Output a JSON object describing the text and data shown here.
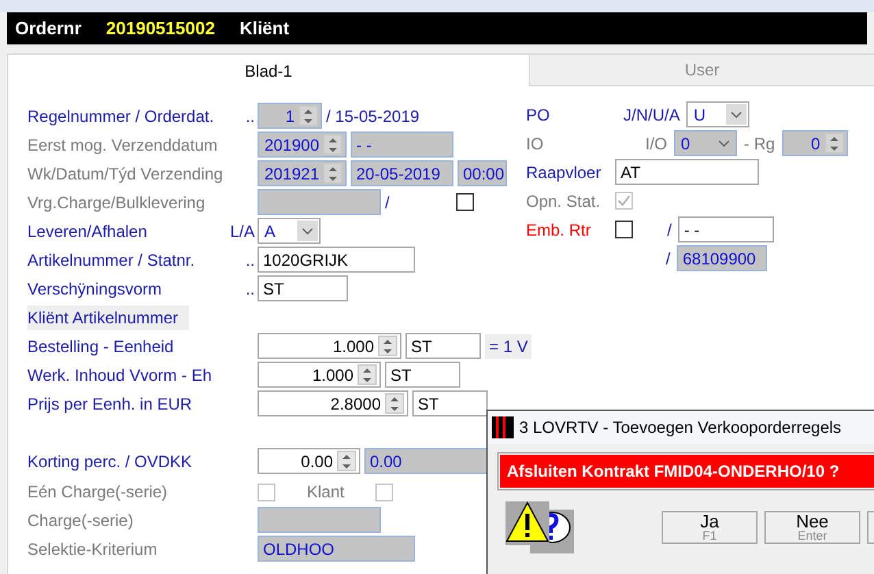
{
  "header": {
    "label": "Ordernr",
    "order_number": "20190515002",
    "client_label": "Kliënt"
  },
  "tabs": [
    {
      "label": "Blad-1",
      "selected": true
    },
    {
      "label": "User",
      "selected": false
    }
  ],
  "left_rows": [
    {
      "label": "Regelnummer / Orderdat.",
      "disabled": false,
      "highlighted": false,
      "gap_before": false,
      "marker": "..",
      "controls": [
        {
          "kind": "spin",
          "value": "1",
          "disabled": true
        },
        {
          "kind": "text",
          "value": "/ 15-05-2019",
          "disabled": false
        }
      ]
    },
    {
      "label": "Eerst mog. Verzenddatum",
      "disabled": true,
      "highlighted": false,
      "gap_before": false,
      "controls": [
        {
          "kind": "spin",
          "value": "201900",
          "disabled": true
        },
        {
          "kind": "field",
          "value": "- -",
          "disabled": true
        }
      ]
    },
    {
      "label": "Wk/Datum/Týd Verzending",
      "disabled": true,
      "highlighted": false,
      "gap_before": false,
      "controls": [
        {
          "kind": "spin",
          "value": "201921",
          "disabled": true
        },
        {
          "kind": "field",
          "value": "20-05-2019",
          "disabled": true
        },
        {
          "kind": "field",
          "value": "00:00",
          "disabled": true
        }
      ]
    },
    {
      "label": "Vrg.Charge/Bulklevering",
      "disabled": true,
      "highlighted": false,
      "gap_before": false,
      "controls": [
        {
          "kind": "field",
          "disabled": true
        },
        {
          "kind": "text",
          "value": "/",
          "disabled": false
        },
        {
          "kind": "check",
          "checked": false,
          "disabled": false
        }
      ]
    },
    {
      "label": "Leveren/Afhalen",
      "disabled": false,
      "highlighted": false,
      "gap_before": false,
      "marker": "L/A",
      "controls": [
        {
          "kind": "combo",
          "value": "A",
          "disabled": false
        }
      ]
    },
    {
      "label": "Artikelnummer / Statnr.",
      "disabled": false,
      "highlighted": false,
      "gap_before": false,
      "marker": "..",
      "controls": [
        {
          "kind": "field",
          "value": "1020GRIJK",
          "disabled": false
        }
      ]
    },
    {
      "label": "Verschÿningsvorm",
      "disabled": false,
      "highlighted": false,
      "gap_before": false,
      "marker": "..",
      "controls": [
        {
          "kind": "field",
          "value": "ST",
          "disabled": false
        }
      ]
    },
    {
      "label": "Kliënt Artikelnummer",
      "disabled": false,
      "highlighted": true,
      "gap_before": false,
      "controls": []
    },
    {
      "label": "Bestelling - Eenheid",
      "disabled": false,
      "highlighted": false,
      "gap_before": false,
      "controls": [
        {
          "kind": "spin",
          "value": "1.000",
          "disabled": false
        },
        {
          "kind": "field",
          "value": "ST",
          "disabled": false
        },
        {
          "kind": "note",
          "value": "= 1 V"
        }
      ]
    },
    {
      "label": "Werk. Inhoud Vvorm - Eh",
      "disabled": false,
      "highlighted": false,
      "gap_before": false,
      "controls": [
        {
          "kind": "spin",
          "value": "1.000",
          "disabled": false
        },
        {
          "kind": "field",
          "value": "ST",
          "disabled": false
        }
      ]
    },
    {
      "label": "Prijs per Eenh. in EUR",
      "disabled": false,
      "highlighted": false,
      "gap_before": false,
      "controls": [
        {
          "kind": "spin",
          "value": "2.8000",
          "disabled": false
        },
        {
          "kind": "field",
          "value": "ST",
          "disabled": false
        }
      ]
    },
    {
      "label": "Korting perc. / OVDKK",
      "disabled": false,
      "highlighted": false,
      "gap_before": true,
      "controls": [
        {
          "kind": "spin",
          "value": "0.00",
          "disabled": false
        },
        {
          "kind": "field",
          "value": "0.00",
          "disabled": true
        }
      ]
    },
    {
      "label": "Eén Charge(-serie)",
      "disabled": true,
      "highlighted": false,
      "gap_before": false,
      "controls": [
        {
          "kind": "check",
          "checked": false,
          "disabled": true
        },
        {
          "kind": "text",
          "value": "Klant",
          "disabled": true
        },
        {
          "kind": "check",
          "checked": false,
          "disabled": true
        }
      ]
    },
    {
      "label": "Charge(-serie)",
      "disabled": true,
      "highlighted": false,
      "gap_before": false,
      "controls": [
        {
          "kind": "field",
          "disabled": true
        }
      ]
    },
    {
      "label": "Selektie-Kriterium",
      "disabled": true,
      "highlighted": false,
      "gap_before": false,
      "controls": [
        {
          "kind": "field",
          "value": "OLDHOO",
          "disabled": true
        }
      ]
    }
  ],
  "right_rows": [
    {
      "label": "PO",
      "disabled": false,
      "alert": false,
      "controls": [
        {
          "kind": "text",
          "value": "J/N/U/A",
          "disabled": false
        },
        {
          "kind": "combo",
          "value": "U",
          "disabled": false
        }
      ]
    },
    {
      "label": "IO",
      "disabled": true,
      "alert": false,
      "controls": [
        {
          "kind": "text",
          "value": "I/O",
          "disabled": true
        },
        {
          "kind": "combo",
          "value": "0",
          "disabled": true
        },
        {
          "kind": "text",
          "value": "- Rg",
          "disabled": true
        },
        {
          "kind": "spin",
          "value": "0",
          "disabled": true
        }
      ]
    },
    {
      "label": "Raapvloer",
      "disabled": false,
      "alert": false,
      "controls": [
        {
          "kind": "field",
          "value": "AT",
          "disabled": false
        }
      ]
    },
    {
      "label": "Opn. Stat.",
      "disabled": true,
      "alert": false,
      "controls": [
        {
          "kind": "check",
          "checked": true,
          "disabled": true
        }
      ]
    },
    {
      "label": "Emb. Rtr",
      "disabled": false,
      "alert": true,
      "controls": [
        {
          "kind": "check",
          "checked": false,
          "disabled": false
        },
        {
          "kind": "text",
          "value": "/",
          "disabled": false
        },
        {
          "kind": "field",
          "value": "- -",
          "disabled": false
        }
      ]
    },
    {
      "controls": [
        {
          "kind": "text",
          "value": "/",
          "disabled": false
        },
        {
          "kind": "field",
          "value": "68109900",
          "disabled": true
        }
      ]
    }
  ],
  "dialog": {
    "title": "3 LOVRTV - Toevoegen Verkooporderregels",
    "message": "Afsluiten Kontrakt FMID04-ONDERHO/10 ?",
    "buttons": [
      {
        "kind": "labeled",
        "label": "Ja",
        "shortcut": "F1"
      },
      {
        "kind": "labeled",
        "label": "Nee",
        "shortcut": "Enter"
      },
      {
        "kind": "blank"
      }
    ]
  }
}
